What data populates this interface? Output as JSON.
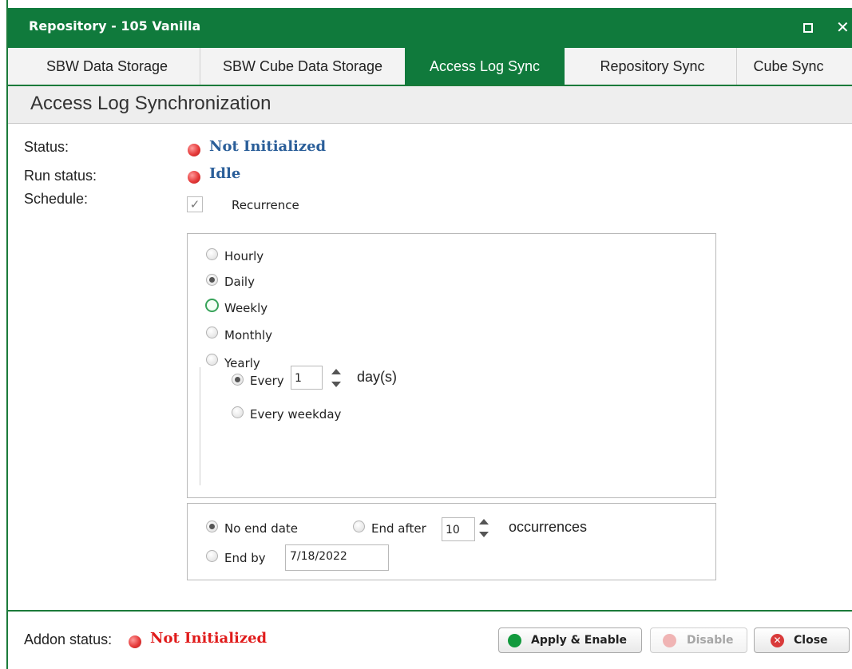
{
  "window": {
    "title": "Repository - 105 Vanilla"
  },
  "tabs": [
    {
      "label": "SBW Data Storage"
    },
    {
      "label": "SBW Cube Data Storage"
    },
    {
      "label": "Access Log Sync",
      "active": true
    },
    {
      "label": "Repository Sync"
    },
    {
      "label": "Cube Sync"
    }
  ],
  "page": {
    "heading": "Access Log Synchronization"
  },
  "form": {
    "status_label": "Status:",
    "status_value": "Not Initialized",
    "run_status_label": "Run status:",
    "run_status_value": "Idle",
    "schedule_label": "Schedule:",
    "recurrence_label": "Recurrence",
    "recurrence_checked": true,
    "recurrence_checkmark": "✓"
  },
  "recurrence": {
    "options": [
      "Hourly",
      "Daily",
      "Weekly",
      "Monthly",
      "Yearly"
    ],
    "selected": "Daily",
    "every_label": "Every",
    "every_value": "1",
    "every_unit": "day(s)",
    "every_weekday_label": "Every weekday",
    "every_selected": "Every"
  },
  "end": {
    "no_end_label": "No end date",
    "end_after_label": "End after",
    "end_after_value": "10",
    "occurrences_label": "occurrences",
    "end_by_label": "End by",
    "end_by_value": "7/18/2022",
    "selected": "No end date"
  },
  "footer": {
    "addon_label": "Addon status:",
    "addon_value": "Not Initialized",
    "addon_color": "#e01b1b",
    "apply_label": "Apply & Enable",
    "disable_label": "Disable",
    "close_label": "Close"
  },
  "colors": {
    "brand": "#107a3c",
    "status_blue": "#2a5e99",
    "error_red": "#e01b1b"
  }
}
